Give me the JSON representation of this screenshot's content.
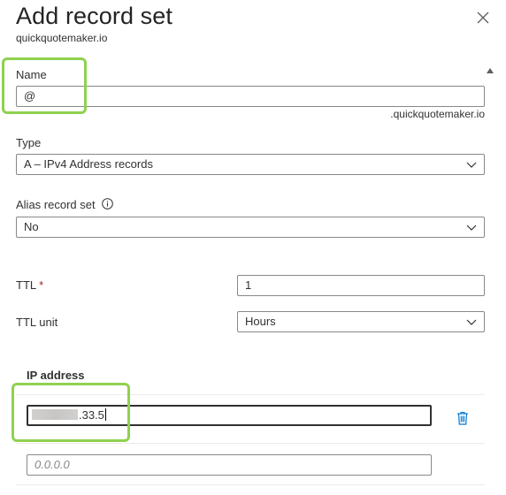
{
  "header": {
    "title": "Add record set",
    "subtitle": "quickquotemaker.io",
    "close_icon": "close-icon"
  },
  "form": {
    "name": {
      "label": "Name",
      "value": "@",
      "suffix": ".quickquotemaker.io"
    },
    "type": {
      "label": "Type",
      "value": "A – IPv4 Address records"
    },
    "alias": {
      "label": "Alias record set",
      "value": "No",
      "info_icon": "info-icon"
    },
    "ttl": {
      "label": "TTL",
      "required_mark": "*",
      "value": "1"
    },
    "ttl_unit": {
      "label": "TTL unit",
      "value": "Hours"
    }
  },
  "ip_section": {
    "header": "IP address",
    "rows": [
      {
        "value_visible": ".33.5",
        "redacted": true
      }
    ],
    "new_row_placeholder": "0.0.0.0",
    "delete_icon": "trash-icon"
  },
  "colors": {
    "highlight": "#8fd14f",
    "delete_icon": "#0078d4"
  }
}
